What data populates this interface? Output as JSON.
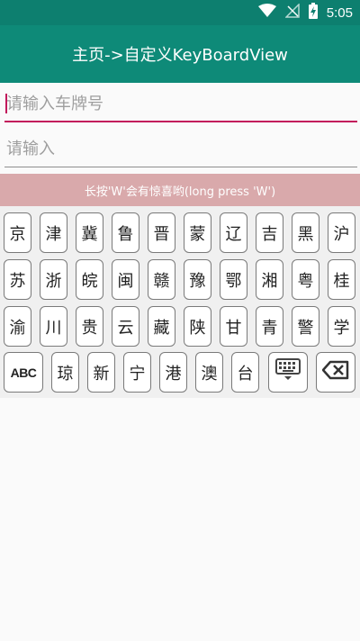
{
  "status_bar": {
    "time": "5:05",
    "icons": [
      "wifi-icon",
      "signal-off-icon",
      "battery-charging-icon"
    ]
  },
  "app_bar": {
    "title": "主页->自定义KeyBoardView"
  },
  "form": {
    "plate_placeholder": "请输入车牌号",
    "plain_placeholder": "请输入"
  },
  "hint": {
    "text": "长按'W'会有惊喜哟(long press 'W')"
  },
  "keyboard": {
    "row1": [
      "京",
      "津",
      "冀",
      "鲁",
      "晋",
      "蒙",
      "辽",
      "吉",
      "黑",
      "沪"
    ],
    "row2": [
      "苏",
      "浙",
      "皖",
      "闽",
      "赣",
      "豫",
      "鄂",
      "湘",
      "粤",
      "桂"
    ],
    "row3": [
      "渝",
      "川",
      "贵",
      "云",
      "藏",
      "陕",
      "甘",
      "青",
      "警",
      "学"
    ],
    "row4": [
      "琼",
      "新",
      "宁",
      "港",
      "澳",
      "台"
    ],
    "abc_label": "ABC",
    "hide_icon": "keyboard-hide-icon",
    "delete_icon": "backspace-icon"
  },
  "colors": {
    "status_bar": "#0d7f6f",
    "app_bar": "#0e8a78",
    "accent": "#c2185b",
    "hint_bar": "#d9a9ab"
  }
}
